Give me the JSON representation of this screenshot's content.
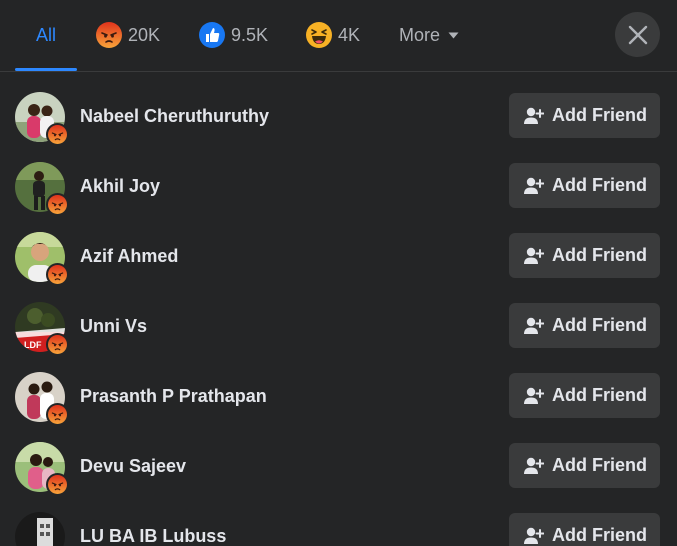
{
  "tabs": [
    {
      "label": "All",
      "icon": ""
    },
    {
      "label": "20K",
      "icon": "angry-reaction-icon"
    },
    {
      "label": "9.5K",
      "icon": "like-reaction-icon"
    },
    {
      "label": "4K",
      "icon": "haha-reaction-icon"
    },
    {
      "label": "More",
      "icon": "caret-down-icon"
    }
  ],
  "colors": {
    "background": "#242526",
    "accent": "#2d88ff",
    "button": "#3a3b3c",
    "angry": "#f0582b",
    "like": "#1877f2",
    "haha": "#f7b125"
  },
  "people": [
    {
      "name": "Nabeel Cheruthuruthy",
      "reaction": "angry-reaction-icon",
      "action": "Add Friend"
    },
    {
      "name": "Akhil Joy",
      "reaction": "angry-reaction-icon",
      "action": "Add Friend"
    },
    {
      "name": "Azif Ahmed",
      "reaction": "angry-reaction-icon",
      "action": "Add Friend"
    },
    {
      "name": "Unni Vs",
      "reaction": "angry-reaction-icon",
      "action": "Add Friend",
      "avatar_text": "LDF"
    },
    {
      "name": "Prasanth P Prathapan",
      "reaction": "angry-reaction-icon",
      "action": "Add Friend"
    },
    {
      "name": "Devu Sajeev",
      "reaction": "angry-reaction-icon",
      "action": "Add Friend"
    },
    {
      "name": "LU BA IB Lubuss",
      "reaction": "",
      "action": "Add Friend"
    }
  ]
}
